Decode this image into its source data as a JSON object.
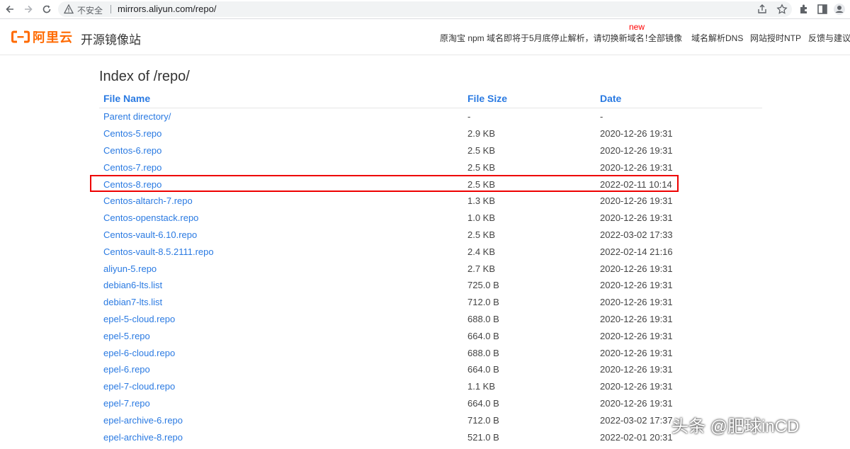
{
  "browser": {
    "security_label": "不安全",
    "url": "mirrors.aliyun.com/repo/"
  },
  "site": {
    "logo_text": "阿里云",
    "title": "开源镜像站",
    "notice": "原淘宝 npm 域名即将于5月底停止解析，请切换新域名！",
    "new_badge": "new",
    "nav": [
      "全部镜像",
      "域名解析DNS",
      "网站授时NTP",
      "反馈与建议"
    ],
    "brand_color": "#ff6a00"
  },
  "listing": {
    "title": "Index of /repo/",
    "headers": {
      "name": "File Name",
      "size": "File Size",
      "date": "Date"
    },
    "rows": [
      {
        "name": "Parent directory/",
        "size": "-",
        "date": "-"
      },
      {
        "name": "Centos-5.repo",
        "size": "2.9 KB",
        "date": "2020-12-26 19:31"
      },
      {
        "name": "Centos-6.repo",
        "size": "2.5 KB",
        "date": "2020-12-26 19:31"
      },
      {
        "name": "Centos-7.repo",
        "size": "2.5 KB",
        "date": "2020-12-26 19:31"
      },
      {
        "name": "Centos-8.repo",
        "size": "2.5 KB",
        "date": "2022-02-11 10:14"
      },
      {
        "name": "Centos-altarch-7.repo",
        "size": "1.3 KB",
        "date": "2020-12-26 19:31"
      },
      {
        "name": "Centos-openstack.repo",
        "size": "1.0 KB",
        "date": "2020-12-26 19:31"
      },
      {
        "name": "Centos-vault-6.10.repo",
        "size": "2.5 KB",
        "date": "2022-03-02 17:33"
      },
      {
        "name": "Centos-vault-8.5.2111.repo",
        "size": "2.4 KB",
        "date": "2022-02-14 21:16"
      },
      {
        "name": "aliyun-5.repo",
        "size": "2.7 KB",
        "date": "2020-12-26 19:31"
      },
      {
        "name": "debian6-lts.list",
        "size": "725.0 B",
        "date": "2020-12-26 19:31"
      },
      {
        "name": "debian7-lts.list",
        "size": "712.0 B",
        "date": "2020-12-26 19:31"
      },
      {
        "name": "epel-5-cloud.repo",
        "size": "688.0 B",
        "date": "2020-12-26 19:31"
      },
      {
        "name": "epel-5.repo",
        "size": "664.0 B",
        "date": "2020-12-26 19:31"
      },
      {
        "name": "epel-6-cloud.repo",
        "size": "688.0 B",
        "date": "2020-12-26 19:31"
      },
      {
        "name": "epel-6.repo",
        "size": "664.0 B",
        "date": "2020-12-26 19:31"
      },
      {
        "name": "epel-7-cloud.repo",
        "size": "1.1 KB",
        "date": "2020-12-26 19:31"
      },
      {
        "name": "epel-7.repo",
        "size": "664.0 B",
        "date": "2020-12-26 19:31"
      },
      {
        "name": "epel-archive-6.repo",
        "size": "712.0 B",
        "date": "2022-03-02 17:37"
      },
      {
        "name": "epel-archive-8.repo",
        "size": "521.0 B",
        "date": "2022-02-01 20:31"
      }
    ],
    "highlighted_row": "Centos-8.repo"
  },
  "watermark": "头条 @肥球inCD"
}
